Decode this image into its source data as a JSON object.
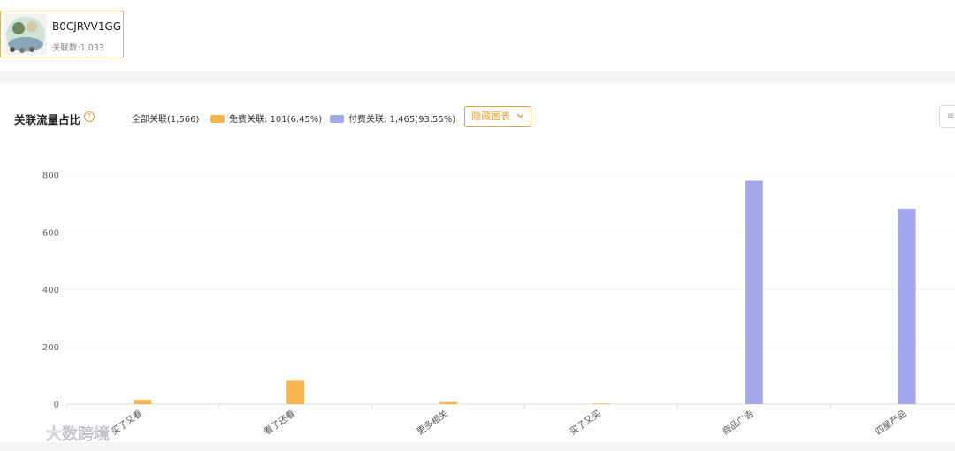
{
  "product": {
    "asin": "B0CJRVV1GG",
    "assoc_count": "关联数:1,033"
  },
  "panel": {
    "title": "关联流量占比",
    "help_icon": "question-circle-icon",
    "all_assoc": "全部关联(1,566)",
    "legend_free": "免费关联: 101(6.45%)",
    "legend_paid": "付费关联: 1,465(93.55%)",
    "hide_chart_label": "隐藏图表",
    "right_button_label": "≡"
  },
  "colors": {
    "free": "#f5b54a",
    "paid": "#a3a8ea",
    "accent": "#e3a23e"
  },
  "watermark": {
    "text": "大数跨境"
  },
  "chart_data": {
    "type": "bar",
    "categories": [
      "买了又看",
      "看了还看",
      "更多相关",
      "买了又买",
      "商品广告",
      "四星产品"
    ],
    "series": [
      {
        "name": "免费关联",
        "values": [
          15,
          82,
          7,
          2,
          0,
          0
        ]
      },
      {
        "name": "付费关联",
        "values": [
          0,
          0,
          0,
          0,
          780,
          683
        ]
      }
    ],
    "ylim": [
      0,
      800
    ],
    "yticks": [
      0,
      200,
      400,
      600,
      800
    ],
    "grid": true
  }
}
